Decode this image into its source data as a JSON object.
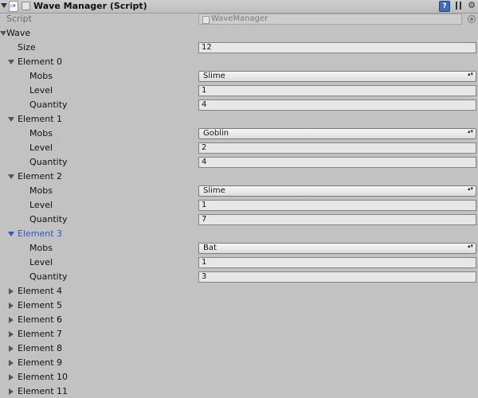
{
  "component": {
    "title": "Wave Manager (Script)",
    "help_glyph": "?",
    "gear_glyph": "⚙"
  },
  "script": {
    "label": "Script",
    "value": "WaveManager"
  },
  "wave": {
    "label": "Wave",
    "size_label": "Size",
    "size": "12",
    "elements": [
      {
        "label": "Element 0",
        "mobs_label": "Mobs",
        "mobs": "Slime",
        "level_label": "Level",
        "level": "1",
        "quantity_label": "Quantity",
        "quantity": "4"
      },
      {
        "label": "Element 1",
        "mobs_label": "Mobs",
        "mobs": "Goblin",
        "level_label": "Level",
        "level": "2",
        "quantity_label": "Quantity",
        "quantity": "4"
      },
      {
        "label": "Element 2",
        "mobs_label": "Mobs",
        "mobs": "Slime",
        "level_label": "Level",
        "level": "1",
        "quantity_label": "Quantity",
        "quantity": "7"
      },
      {
        "label": "Element 3",
        "mobs_label": "Mobs",
        "mobs": "Bat",
        "level_label": "Level",
        "level": "1",
        "quantity_label": "Quantity",
        "quantity": "3"
      },
      {
        "label": "Element 4"
      },
      {
        "label": "Element 5"
      },
      {
        "label": "Element 6"
      },
      {
        "label": "Element 7"
      },
      {
        "label": "Element 8"
      },
      {
        "label": "Element 9"
      },
      {
        "label": "Element 10"
      },
      {
        "label": "Element 11"
      }
    ]
  },
  "dropdown_arrow_glyph": "▴▾",
  "colors": {
    "selected_text": "#2f57c7",
    "panel_background": "#c2c2c2"
  }
}
